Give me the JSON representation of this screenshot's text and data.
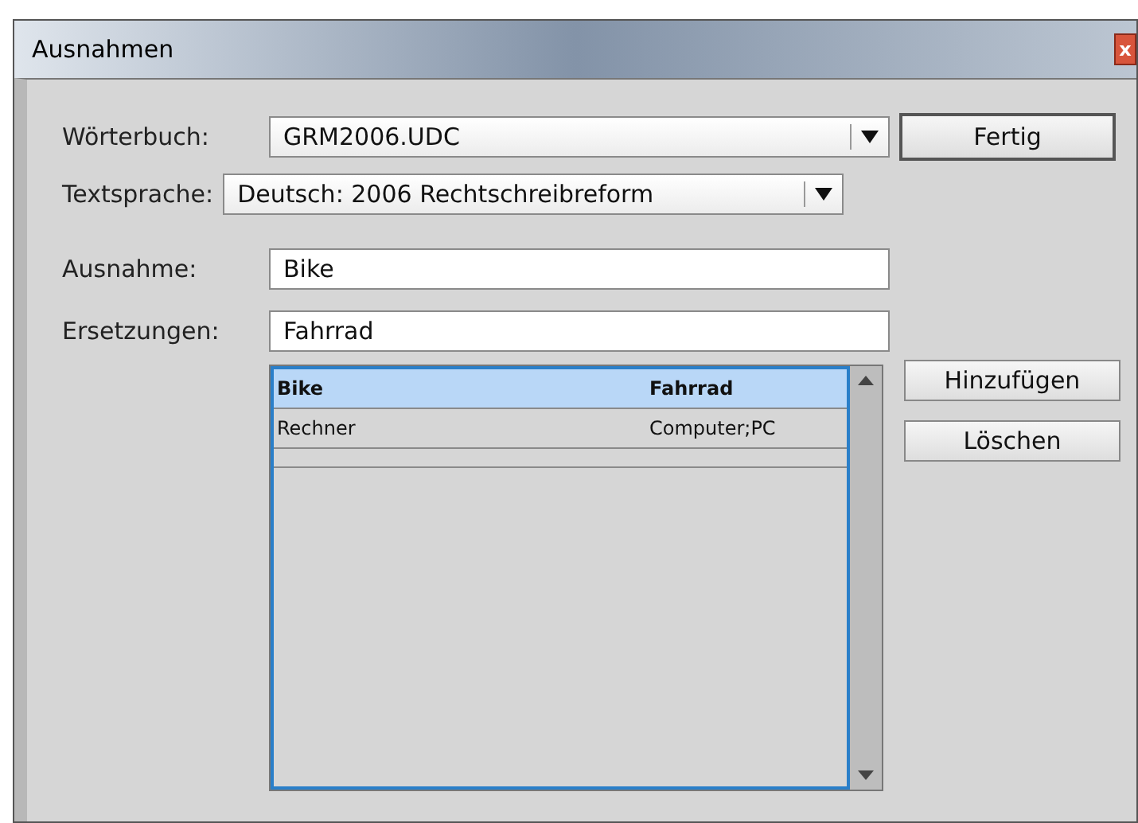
{
  "window": {
    "title": "Ausnahmen",
    "close": "x"
  },
  "dictionary": {
    "label": "Wörterbuch:",
    "value": "GRM2006.UDC"
  },
  "language": {
    "label": "Textsprache:",
    "value": "Deutsch: 2006 Rechtschreibreform"
  },
  "exception": {
    "label": "Ausnahme:",
    "value": "Bike"
  },
  "replacements": {
    "label": "Ersetzungen:",
    "value": "Fahrrad"
  },
  "list": {
    "rows": [
      {
        "word": "Bike",
        "replacement": "Fahrrad",
        "selected": true
      },
      {
        "word": "Rechner",
        "replacement": "Computer;PC",
        "selected": false
      }
    ]
  },
  "buttons": {
    "done": "Fertig",
    "add": "Hinzufügen",
    "delete": "Löschen"
  }
}
